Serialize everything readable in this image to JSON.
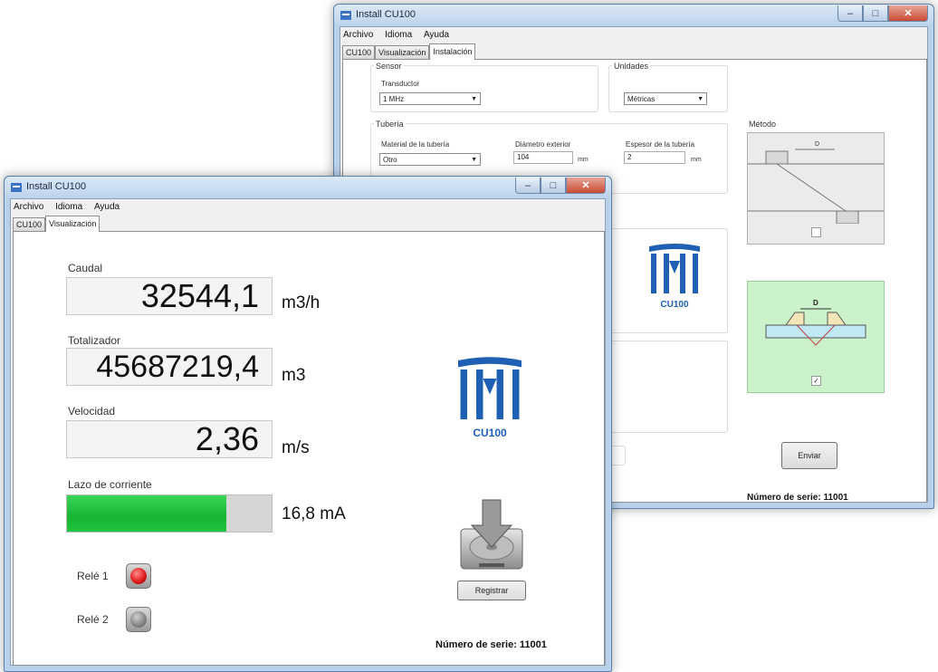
{
  "back_window": {
    "title": "Install CU100",
    "menu": [
      "Archivo",
      "Idioma",
      "Ayuda"
    ],
    "tabs": [
      "CU100",
      "Visualización",
      "Instalación"
    ],
    "sensor": {
      "group_label": "Sensor",
      "transductor_label": "Transductor",
      "transductor_value": "1 MHz"
    },
    "unidades": {
      "group_label": "Unidades",
      "value": "Métricas"
    },
    "tuberia": {
      "group_label": "Tubería",
      "material_label": "Material de la tubería",
      "material_value": "Otro",
      "diametro_label": "Diámetro exterior",
      "diametro_value": "104",
      "diametro_unit": "mm",
      "espesor_label": "Espesor de la tubería",
      "espesor_value": "2",
      "espesor_unit": "mm"
    },
    "metodo_label": "Método",
    "diagram_dim_label": "D",
    "logo_text": "CU100",
    "enviar_label": "Enviar",
    "serial": "Número de serie: 11001"
  },
  "front_window": {
    "title": "Install CU100",
    "menu": [
      "Archivo",
      "Idioma",
      "Ayuda"
    ],
    "tabs": [
      "CU100",
      "Visualización"
    ],
    "caudal": {
      "label": "Caudal",
      "value": "32544,1",
      "unit": "m3/h"
    },
    "totalizador": {
      "label": "Totalizador",
      "value": "45687219,4",
      "unit": "m3"
    },
    "velocidad": {
      "label": "Velocidad",
      "value": "2,36",
      "unit": "m/s"
    },
    "lazo": {
      "label": "Lazo de corriente",
      "value": "16,8 mA",
      "fill_fraction": 0.78
    },
    "rele1": {
      "label": "Relé 1",
      "state": "on"
    },
    "rele2": {
      "label": "Relé 2",
      "state": "off"
    },
    "logo_text": "CU100",
    "registrar_label": "Registrar",
    "serial": "Número de serie: 11001"
  },
  "colors": {
    "logo_blue": "#1f5fb4",
    "bar_green": "#1fc43c",
    "relay_red": "#e01e1e",
    "diagram_green": "#ccf2cc"
  }
}
